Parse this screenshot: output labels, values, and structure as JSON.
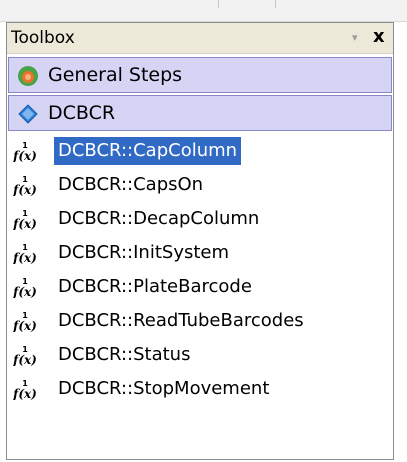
{
  "toolbox": {
    "title": "Toolbox",
    "dropdown_glyph": "▾",
    "close_glyph": "x"
  },
  "categories": [
    {
      "label": "General Steps",
      "icon": "general-steps-icon"
    },
    {
      "label": "DCBCR",
      "icon": "diamond-icon"
    }
  ],
  "items": [
    {
      "label": "DCBCR::CapColumn",
      "selected": true
    },
    {
      "label": "DCBCR::CapsOn",
      "selected": false
    },
    {
      "label": "DCBCR::DecapColumn",
      "selected": false
    },
    {
      "label": "DCBCR::InitSystem",
      "selected": false
    },
    {
      "label": "DCBCR::PlateBarcode",
      "selected": false
    },
    {
      "label": "DCBCR::ReadTubeBarcodes",
      "selected": false
    },
    {
      "label": "DCBCR::Status",
      "selected": false
    },
    {
      "label": "DCBCR::StopMovement",
      "selected": false
    }
  ],
  "colors": {
    "selection": "#316ac5",
    "category_bg": "#d6d4f5",
    "general_icon_ring": "#4aa34a",
    "general_icon_center": "#e8732a",
    "diamond_icon": "#2f7fd8"
  }
}
